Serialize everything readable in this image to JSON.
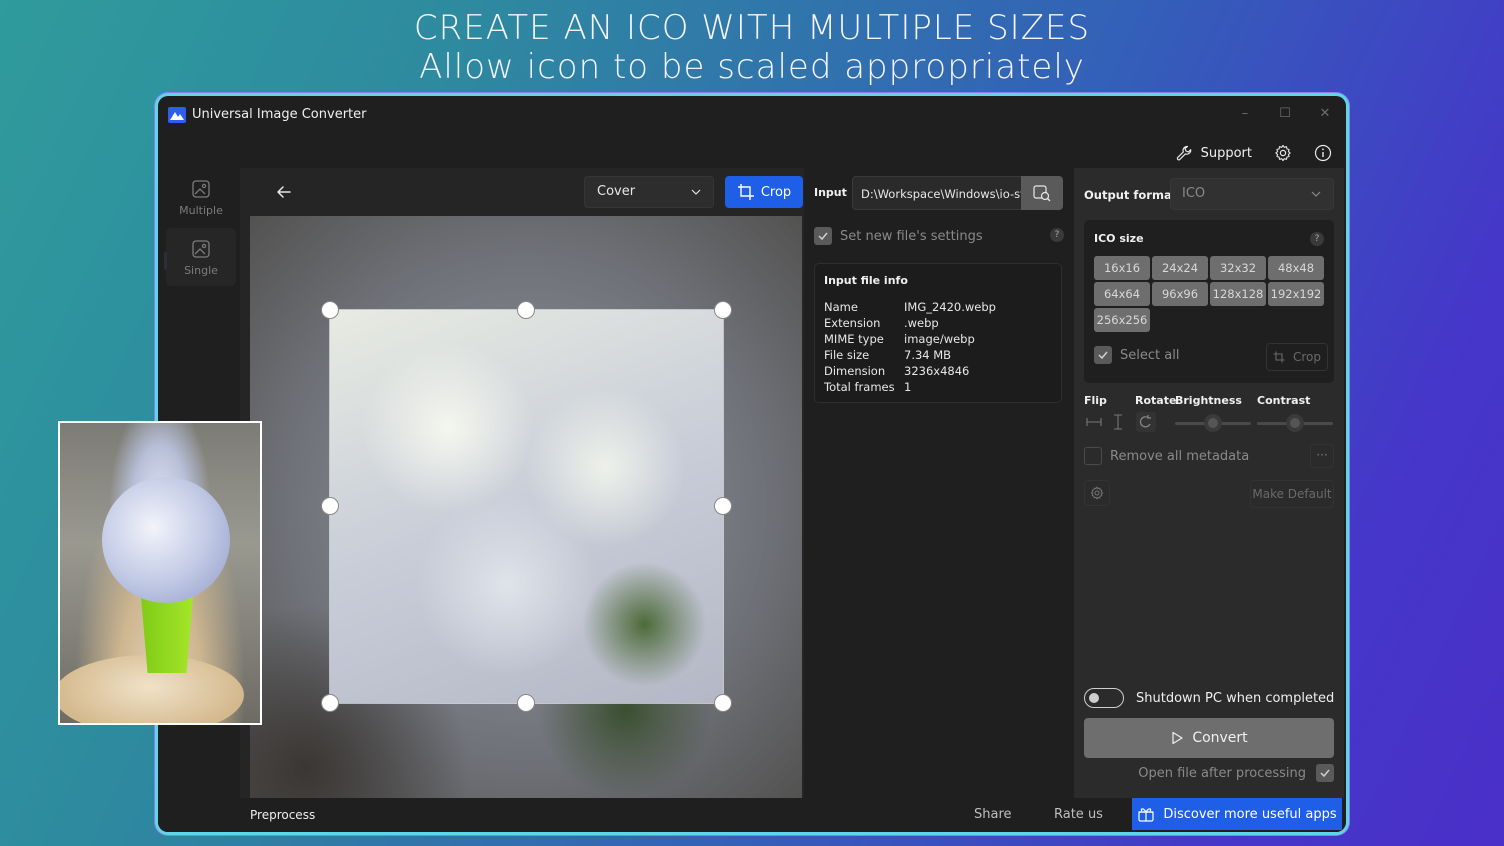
{
  "headline": {
    "line1": "CREATE AN ICO WITH MULTIPLE SIZES",
    "line2": "Allow icon to be scaled appropriately"
  },
  "window": {
    "title": "Universal Image Converter",
    "controls": {
      "minimize": "–",
      "maximize": "☐",
      "close": "✕"
    }
  },
  "top_actions": {
    "support_label": "Support"
  },
  "nav": {
    "items": [
      {
        "label": "Multiple",
        "icon": "image-stack-icon"
      },
      {
        "label": "Single",
        "icon": "image-icon",
        "active": true
      }
    ]
  },
  "editor": {
    "mode_select": "Cover",
    "crop_label": "Crop"
  },
  "input": {
    "label": "Input",
    "path": "D:\\Workspace\\Windows\\io-str",
    "set_new_settings_label": "Set new file's settings",
    "set_new_settings_checked": true,
    "help": "?"
  },
  "file_info": {
    "title": "Input file info",
    "rows": [
      {
        "key": "Name",
        "value": "IMG_2420.webp"
      },
      {
        "key": "Extension",
        "value": ".webp"
      },
      {
        "key": "MIME type",
        "value": "image/webp"
      },
      {
        "key": "File size",
        "value": "7.34 MB"
      },
      {
        "key": "Dimension",
        "value": "3236x4846"
      },
      {
        "key": "Total frames",
        "value": "1"
      }
    ]
  },
  "settings": {
    "output_format_label": "Output format",
    "output_format_value": "ICO",
    "ico_size": {
      "title": "ICO size",
      "help": "?",
      "sizes": [
        "16x16",
        "24x24",
        "32x32",
        "48x48",
        "64x64",
        "96x96",
        "128x128",
        "192x192",
        "256x256"
      ],
      "select_all_label": "Select all",
      "select_all_checked": true,
      "crop_label": "Crop"
    },
    "tools": {
      "flip": "Flip",
      "rotate": "Rotate",
      "brightness": "Brightness",
      "contrast": "Contrast",
      "brightness_level": 0.5,
      "contrast_level": 0.5
    },
    "remove_metadata_label": "Remove all metadata",
    "remove_metadata_checked": false,
    "more_label": "···",
    "make_default_label": "Make Default",
    "shutdown_label": "Shutdown PC when completed",
    "shutdown_on": false,
    "convert_label": "Convert",
    "open_after_label": "Open file after processing",
    "open_after_checked": true
  },
  "bottombar": {
    "preprocess_label": "Preprocess",
    "share_label": "Share",
    "rate_label": "Rate us",
    "discover_label": "Discover more useful apps"
  },
  "colors": {
    "accent": "#1f5fe8",
    "window_bg": "#1f1f1f",
    "frame_glow": "#5fd6e8"
  }
}
